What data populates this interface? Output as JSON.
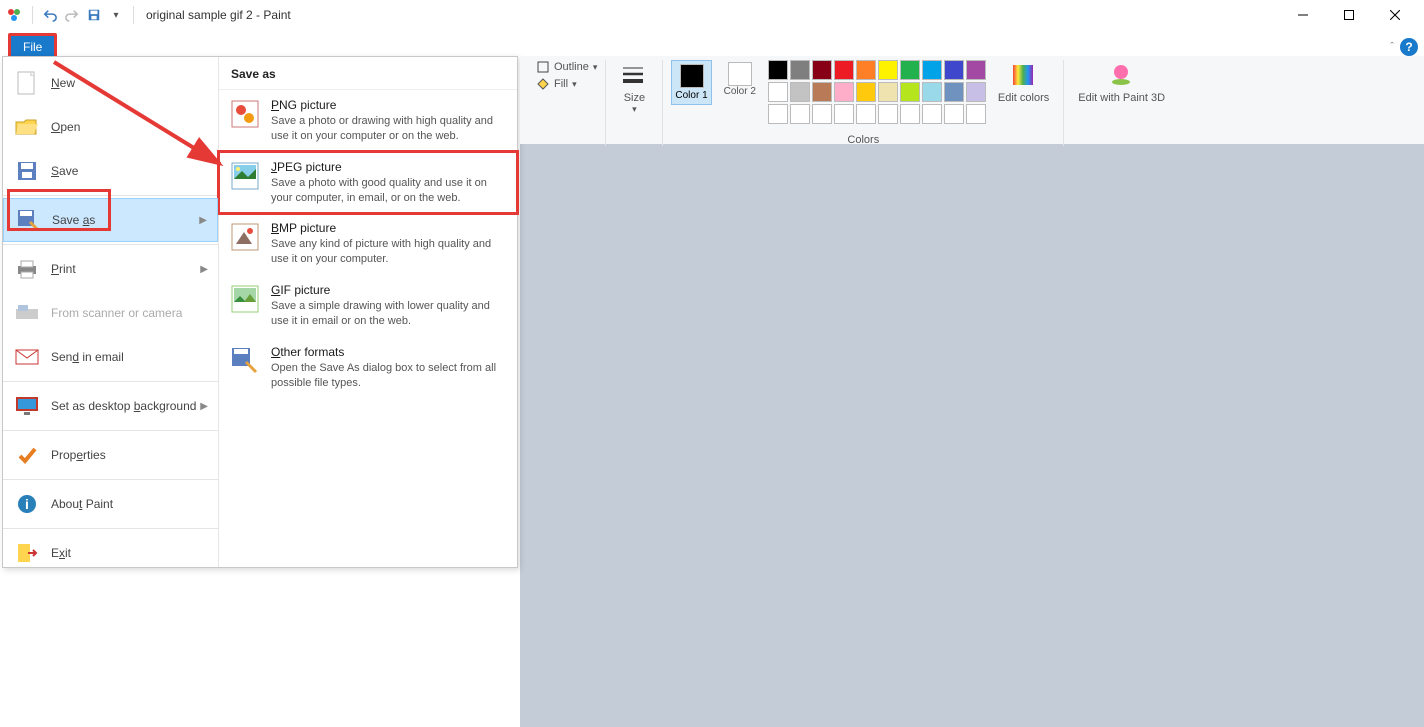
{
  "title": "original sample gif 2 - Paint",
  "file_button": "File",
  "help_row": {
    "caret": "ˆ"
  },
  "menu": {
    "new": "New",
    "open": "Open",
    "save": "Save",
    "save_as": "Save as",
    "print": "Print",
    "from_scanner": "From scanner or camera",
    "send_email": "Send in email",
    "desktop_bg": "Set as desktop background",
    "properties": "Properties",
    "about": "About Paint",
    "exit": "Exit"
  },
  "save_as_panel": {
    "header": "Save as",
    "items": [
      {
        "title": "PNG picture",
        "desc": "Save a photo or drawing with high quality and use it on your computer or on the web."
      },
      {
        "title": "JPEG picture",
        "desc": "Save a photo with good quality and use it on your computer, in email, or on the web."
      },
      {
        "title": "BMP picture",
        "desc": "Save any kind of picture with high quality and use it on your computer."
      },
      {
        "title": "GIF picture",
        "desc": "Save a simple drawing with lower quality and use it in email or on the web."
      },
      {
        "title": "Other formats",
        "desc": "Open the Save As dialog box to select from all possible file types."
      }
    ]
  },
  "ribbon": {
    "outline": "Outline",
    "fill": "Fill",
    "size": "Size",
    "color1": "Color 1",
    "color2": "Color 2",
    "colors_group": "Colors",
    "edit_colors": "Edit colors",
    "edit_3d": "Edit with Paint 3D",
    "palette_row1": [
      "#000000",
      "#7f7f7f",
      "#880015",
      "#ed1c24",
      "#ff7f27",
      "#fff200",
      "#22b14c",
      "#00a2e8",
      "#3f48cc",
      "#a349a4"
    ],
    "palette_row2": [
      "#ffffff",
      "#c3c3c3",
      "#b97a57",
      "#ffaec9",
      "#ffc90e",
      "#efe4b0",
      "#b5e61d",
      "#99d9ea",
      "#7092be",
      "#c8bfe7"
    ]
  }
}
